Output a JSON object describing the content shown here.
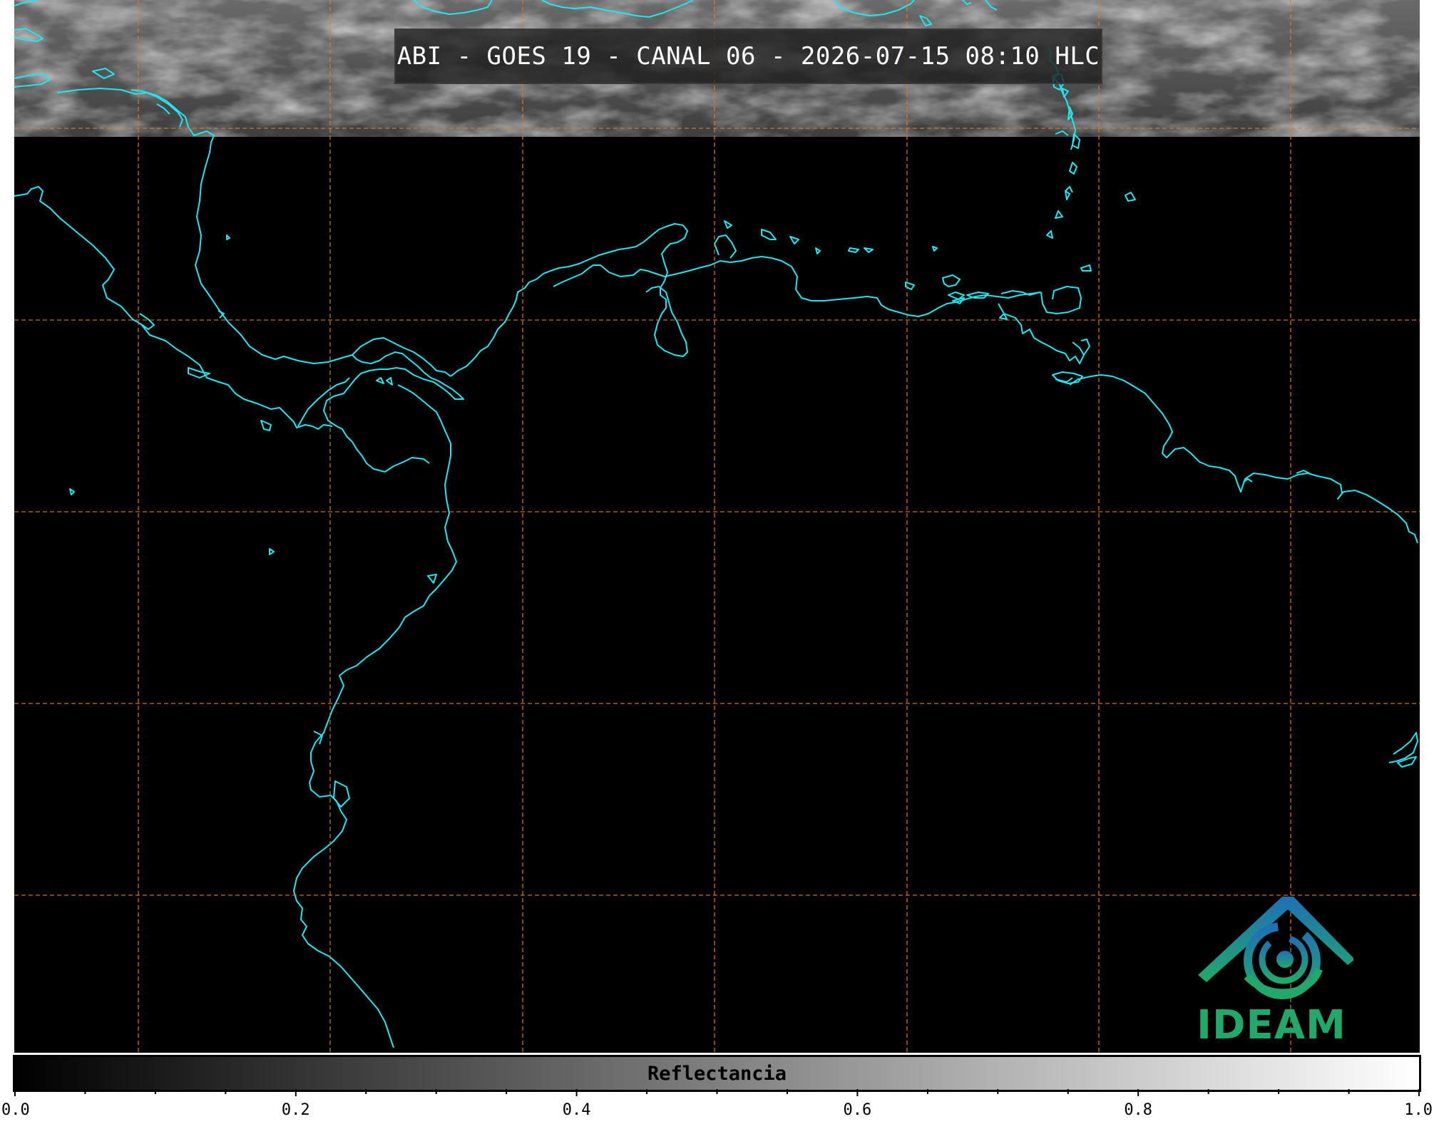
{
  "title": "ABI - GOES 19 - CANAL 06 - 2026-07-15 08:10 HLC",
  "colors": {
    "coastline": "#22e6f0",
    "gridline": "#e07a2a",
    "background": "#000000",
    "logo_blue": "#1f6fb5",
    "logo_green": "#22a86b"
  },
  "logo": {
    "text": "IDEAM",
    "icon": "ideam-swirl-mountain-icon"
  },
  "colorbar": {
    "label": "Reflectancia",
    "min": 0.0,
    "max": 1.0,
    "colormap": "grayscale",
    "major_ticks": [
      "0.0",
      "0.2",
      "0.4",
      "0.6",
      "0.8",
      "1.0"
    ],
    "minor_tick_step": 0.05
  }
}
